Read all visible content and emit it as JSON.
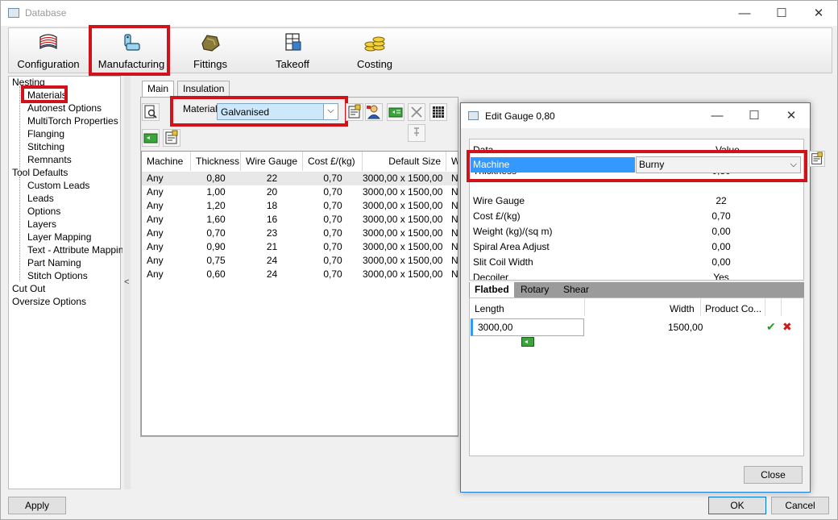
{
  "window": {
    "title": "Database",
    "minimize": "—",
    "maximize": "☐",
    "close": "✕"
  },
  "ribbon": {
    "items": [
      {
        "label": "Configuration"
      },
      {
        "label": "Manufacturing"
      },
      {
        "label": "Fittings"
      },
      {
        "label": "Takeoff"
      },
      {
        "label": "Costing"
      }
    ]
  },
  "tree": {
    "nodes": [
      "Nesting",
      "Materials",
      "Autonest Options",
      "MultiTorch Properties",
      "Flanging",
      "Stitching",
      "Remnants",
      "Tool Defaults",
      "Custom Leads",
      "Leads",
      "Options",
      "Layers",
      "Layer Mapping",
      "Text - Attribute Mapping",
      "Part Naming",
      "Stitch Options",
      "Cut Out",
      "Oversize Options"
    ]
  },
  "splitter": {
    "glyph": "<"
  },
  "tabs": {
    "main": "Main",
    "insulation": "Insulation"
  },
  "material": {
    "label": "Material",
    "value": "Galvanised",
    "arrow": "⌵"
  },
  "table": {
    "headers": [
      "Machine",
      "Thickness",
      "Wire Gauge",
      "Cost £/(kg)",
      "Default Size",
      "We"
    ],
    "rows": [
      [
        "Any",
        "0,80",
        "22",
        "0,70",
        "3000,00 x 1500,00",
        "No"
      ],
      [
        "Any",
        "1,00",
        "20",
        "0,70",
        "3000,00 x 1500,00",
        "No"
      ],
      [
        "Any",
        "1,20",
        "18",
        "0,70",
        "3000,00 x 1500,00",
        "No"
      ],
      [
        "Any",
        "1,60",
        "16",
        "0,70",
        "3000,00 x 1500,00",
        "No"
      ],
      [
        "Any",
        "0,70",
        "23",
        "0,70",
        "3000,00 x 1500,00",
        "No"
      ],
      [
        "Any",
        "0,90",
        "21",
        "0,70",
        "3000,00 x 1500,00",
        "No"
      ],
      [
        "Any",
        "0,75",
        "24",
        "0,70",
        "3000,00 x 1500,00",
        "No"
      ],
      [
        "Any",
        "0,60",
        "24",
        "0,70",
        "3000,00 x 1500,00",
        "No"
      ]
    ]
  },
  "buttons": {
    "apply": "Apply",
    "ok": "OK",
    "cancel": "Cancel"
  },
  "dialog": {
    "title": "Edit Gauge 0,80",
    "minimize": "—",
    "maximize": "☐",
    "close": "✕",
    "col_data": "Data",
    "col_value": "Value",
    "machine_label": "Machine",
    "machine_value": "Burny",
    "machine_arrow": "⌵",
    "props": [
      {
        "k": "Thickness",
        "v": "0,80"
      },
      {
        "k": "Wire Gauge",
        "v": "22"
      },
      {
        "k": "Cost £/(kg)",
        "v": "0,70"
      },
      {
        "k": "Weight (kg)/(sq m)",
        "v": "0,00"
      },
      {
        "k": "Spiral Area Adjust",
        "v": "0,00"
      },
      {
        "k": "Slit Coil Width",
        "v": "0,00"
      },
      {
        "k": "Decoiler",
        "v": "Yes"
      }
    ],
    "tabs": [
      "Flatbed",
      "Rotary",
      "Shear"
    ],
    "flat_headers": {
      "length": "Length",
      "width": "Width",
      "product": "Product Co..."
    },
    "length_value": "3000,00",
    "width_value": "1500,00",
    "close_label": "Close",
    "accept_glyph": "✔",
    "reject_glyph": "✖"
  },
  "colors": {
    "highlight": "#d0121b",
    "selection": "#3399ff",
    "combo_bg": "#cde8fb"
  }
}
